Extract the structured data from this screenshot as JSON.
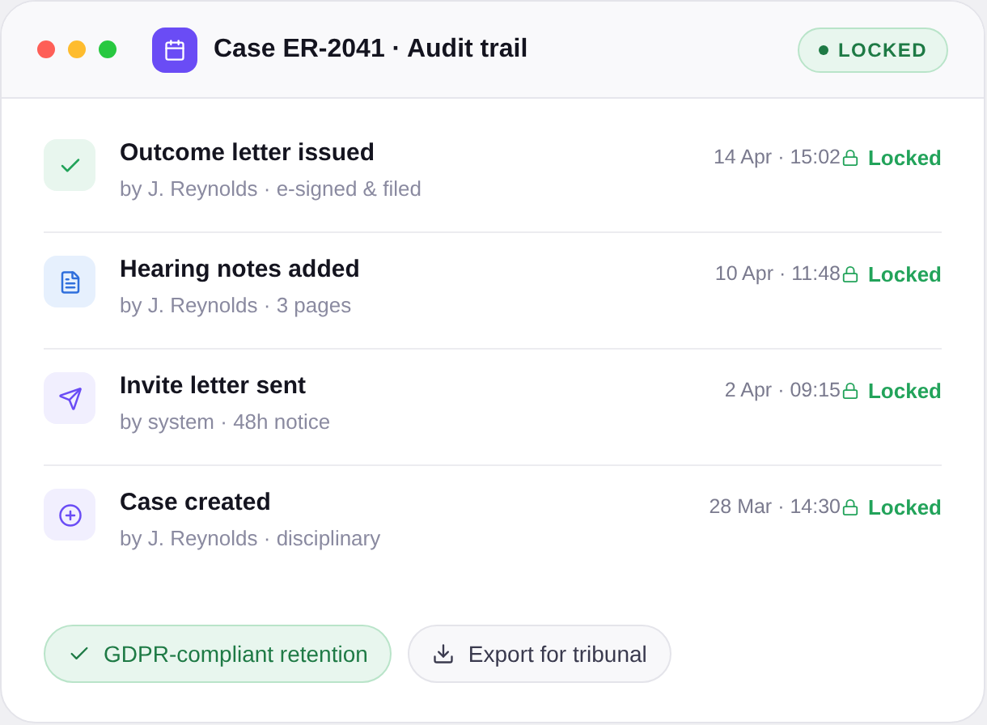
{
  "window": {
    "title": "Case ER-2041 · Audit trail",
    "badge": "LOCKED"
  },
  "events": [
    {
      "kind": "done",
      "title": "Outcome letter issued",
      "detail": "by J. Reynolds · e-signed & filed",
      "time": "14 Apr · 15:02",
      "status": "Locked"
    },
    {
      "kind": "document",
      "title": "Hearing notes added",
      "detail": "by J. Reynolds · 3 pages",
      "time": "10 Apr · 11:48",
      "status": "Locked"
    },
    {
      "kind": "sent",
      "title": "Invite letter sent",
      "detail": "by system · 48h notice",
      "time": "2 Apr · 09:15",
      "status": "Locked"
    },
    {
      "kind": "created",
      "title": "Case created",
      "detail": "by J. Reynolds · disciplinary",
      "time": "28 Mar · 14:30",
      "status": "Locked"
    }
  ],
  "footer": {
    "retention": "GDPR-compliant retention",
    "export": "Export for tribunal"
  }
}
